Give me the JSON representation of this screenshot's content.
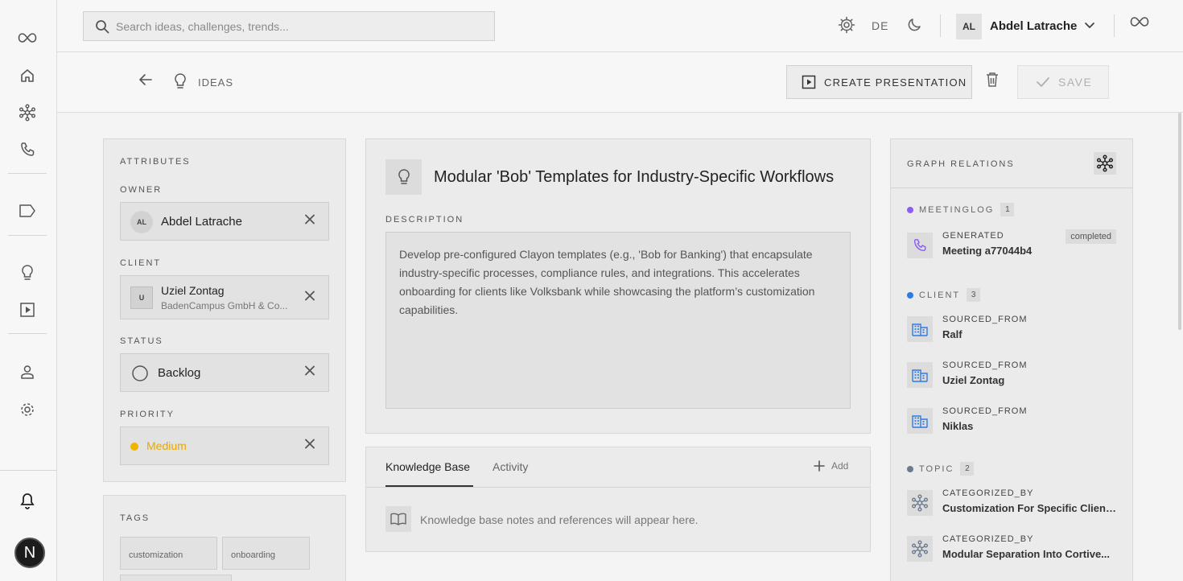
{
  "search": {
    "placeholder": "Search ideas, challenges, trends..."
  },
  "topbar": {
    "language": "DE",
    "user_initials": "AL",
    "user_name": "Abdel Latrache"
  },
  "nav": {
    "next_badge": "N"
  },
  "breadcrumb": {
    "section": "IDEAS"
  },
  "toolbar": {
    "create_presentation": "CREATE PRESENTATION",
    "save": "SAVE"
  },
  "attributes": {
    "heading": "ATTRIBUTES",
    "owner_label": "OWNER",
    "owner": {
      "initials": "AL",
      "name": "Abdel Latrache"
    },
    "client_label": "CLIENT",
    "client": {
      "initials": "U",
      "name": "Uziel Zontag",
      "company": "BadenCampus GmbH & Co..."
    },
    "status_label": "STATUS",
    "status": "Backlog",
    "priority_label": "PRIORITY",
    "priority": "Medium"
  },
  "tags": {
    "heading": "TAGS",
    "items": [
      "customization",
      "onboarding"
    ]
  },
  "idea": {
    "title": "Modular 'Bob' Templates for Industry-Specific Workflows",
    "description_label": "DESCRIPTION",
    "description": "Develop pre-configured Clayon templates (e.g., 'Bob for Banking') that encapsulate industry-specific processes, compliance rules, and integrations. This accelerates onboarding for clients like Volksbank while showcasing the platform’s customization capabilities."
  },
  "kb": {
    "tabs": [
      "Knowledge Base",
      "Activity"
    ],
    "add": "Add",
    "empty": "Knowledge base notes and references will appear here."
  },
  "graph": {
    "heading": "GRAPH RELATIONS",
    "groups": [
      {
        "name": "MEETINGLOG",
        "count": "1",
        "color": "#8b5cf6",
        "items": [
          {
            "rel": "GENERATED",
            "name": "Meeting a77044b4",
            "badge": "completed"
          }
        ]
      },
      {
        "name": "CLIENT",
        "count": "3",
        "color": "#2f7be5",
        "items": [
          {
            "rel": "SOURCED_FROM",
            "name": "Ralf"
          },
          {
            "rel": "SOURCED_FROM",
            "name": "Uziel Zontag"
          },
          {
            "rel": "SOURCED_FROM",
            "name": "Niklas"
          }
        ]
      },
      {
        "name": "TOPIC",
        "count": "2",
        "color": "#6b7a8f",
        "items": [
          {
            "rel": "CATEGORIZED_BY",
            "name": "Customization For Specific Clients..."
          },
          {
            "rel": "CATEGORIZED_BY",
            "name": "Modular Separation Into Cortive..."
          }
        ]
      }
    ]
  },
  "colors": {
    "priority_medium": "#f0b400",
    "meetinglog": "#8b5cf6",
    "client": "#2f7be5",
    "topic": "#6b7a8f"
  }
}
